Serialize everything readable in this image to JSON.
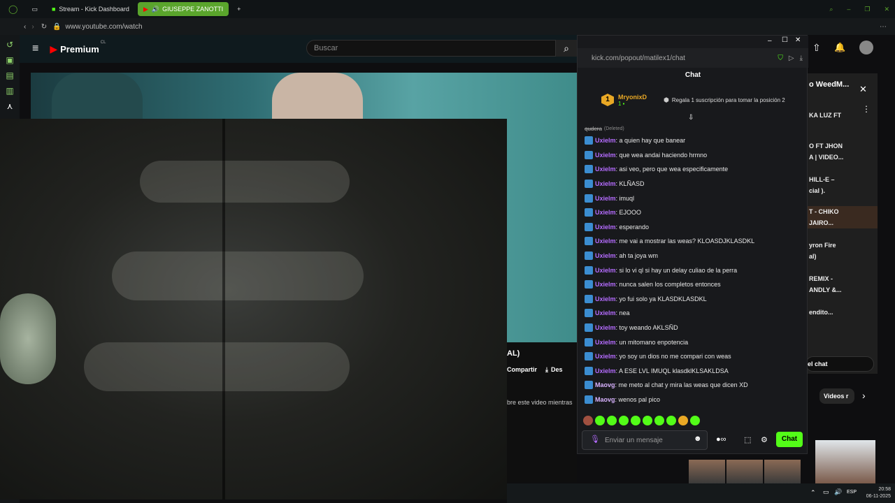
{
  "browser": {
    "tabs": [
      {
        "label": "Stream - Kick Dashboard"
      },
      {
        "label": "GIUSEPPE ZANOTTI"
      }
    ],
    "url": "www.youtube.com/watch"
  },
  "youtube": {
    "logo": "Premium",
    "logo_sup": "CL",
    "search_placeholder": "Buscar",
    "title_fragment": "AL)",
    "share_label": "Compartir",
    "download_fragment": "Des",
    "desc_fragment": "bre este video mientras",
    "right_panel": {
      "header": "o WeedM...",
      "items": [
        "KA LUZ FT",
        "O FT JHON",
        "A | VIDEO...",
        "HILL-E –",
        "cial ).",
        "T - CHIKO",
        "JAIRO...",
        "yron Fire",
        "al)",
        "REMIX -",
        "ANDLY &...",
        "endito..."
      ],
      "live_chat": "el chat",
      "chip": "Videos r"
    }
  },
  "kick": {
    "url": "kick.com/popout/matilex1/chat",
    "title": "Chat",
    "pinned_user": "MryonixD",
    "pinned_count": "1",
    "pinned_rank": "1",
    "pinned_text": "Regala 1 suscripción para tomar la posición 2",
    "deleted_user": "qudera",
    "deleted_text": "(Deleted)",
    "messages": [
      {
        "user": "Uxielm",
        "text": ": a quien hay que banear"
      },
      {
        "user": "Uxielm",
        "text": ": que wea andai haciendo hrmno"
      },
      {
        "user": "Uxielm",
        "text": ": asi veo, pero que wea especificamente"
      },
      {
        "user": "Uxielm",
        "text": ": KLÑASD"
      },
      {
        "user": "Uxielm",
        "text": ": imuql"
      },
      {
        "user": "Uxielm",
        "text": ": EJOOO"
      },
      {
        "user": "Uxielm",
        "text": ": esperando"
      },
      {
        "user": "Uxielm",
        "text": ": me vai a mostrar las weas? KLOASDJKLASDKL"
      },
      {
        "user": "Uxielm",
        "text": ": ah ta joya wm"
      },
      {
        "user": "Uxielm",
        "text": ": si lo vi ql si hay un delay culiao de la perra"
      },
      {
        "user": "Uxielm",
        "text": ": nunca salen los completos entonces"
      },
      {
        "user": "Uxielm",
        "text": ": yo fui solo ya KLASDKLASDKL"
      },
      {
        "user": "Uxielm",
        "text": ": nea"
      },
      {
        "user": "Uxielm",
        "text": ": toy weando AKLSÑD"
      },
      {
        "user": "Uxielm",
        "text": ": un mitomano enpotencia"
      },
      {
        "user": "Uxielm",
        "text": ": yo soy un dios no me compari con weas"
      },
      {
        "user": "Uxielm",
        "text": ": A ESE LVL IMUQL klasdklKLSAKLDSA"
      },
      {
        "user": "Maovg",
        "text": ": me meto al chat y mira las weas que dicen XD"
      },
      {
        "user": "Maovg",
        "text": ": wenos pal pico"
      }
    ],
    "input_placeholder": "Enviar un mensaje",
    "send_label": "Chat"
  },
  "taskbar": {
    "lang": "ESP",
    "time": "20:58",
    "date": "06-11-2025"
  },
  "colors": {
    "kick_green": "#53fc18",
    "opera_green": "#5aa52c",
    "username_purple": "#b56cff"
  }
}
